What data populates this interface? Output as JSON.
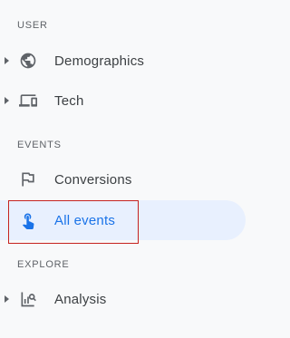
{
  "sections": [
    {
      "header": "USER",
      "items": [
        {
          "label": "Demographics",
          "icon": "globe-icon",
          "expandable": true
        },
        {
          "label": "Tech",
          "icon": "devices-icon",
          "expandable": true
        }
      ]
    },
    {
      "header": "EVENTS",
      "items": [
        {
          "label": "Conversions",
          "icon": "flag-icon",
          "expandable": false
        },
        {
          "label": "All events",
          "icon": "touch-icon",
          "expandable": false,
          "active": true
        }
      ]
    },
    {
      "header": "EXPLORE",
      "items": [
        {
          "label": "Analysis",
          "icon": "analysis-icon",
          "expandable": true
        }
      ]
    }
  ],
  "colors": {
    "active_bg": "#e8f0fe",
    "active_text": "#1a73e8",
    "text": "#3c4043",
    "muted": "#5f6368",
    "focus_outline": "#c5221f"
  }
}
